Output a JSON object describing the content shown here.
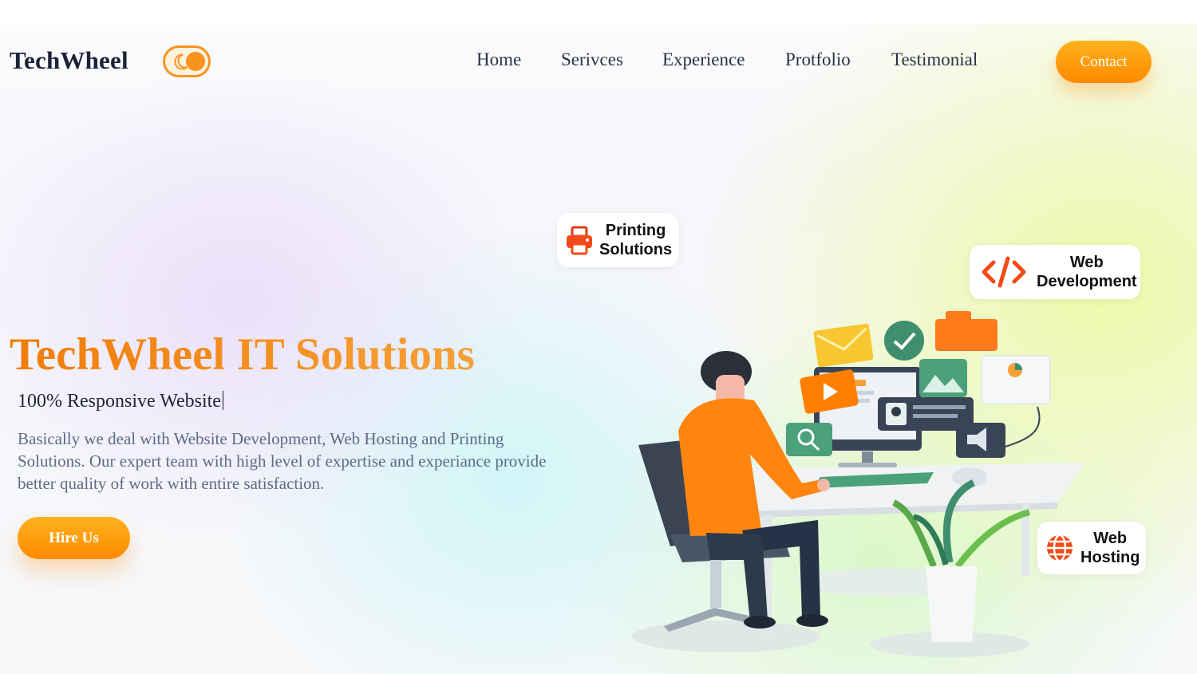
{
  "header": {
    "logo": "TechWheel",
    "nav": [
      {
        "label": "Home"
      },
      {
        "label": "Serivces"
      },
      {
        "label": "Experience"
      },
      {
        "label": "Protfolio"
      },
      {
        "label": "Testimonial"
      }
    ],
    "contact_label": "Contact"
  },
  "hero": {
    "title": "TechWheel IT Solutions",
    "subtitle": "100% Responsive Website",
    "description": "Basically we deal with Website Development, Web Hosting and Printing Solutions. Our expert team with high level of expertise and experiance provide better quality of work with entire satisfaction.",
    "cta_label": "Hire Us"
  },
  "services": {
    "printing": {
      "line1": "Printing",
      "line2": "Solutions",
      "icon": "printer-icon"
    },
    "web_dev": {
      "line1": "Web",
      "line2": "Development",
      "icon": "code-icon"
    },
    "web_hosting": {
      "line1": "Web",
      "line2": "Hosting",
      "icon": "globe-icon"
    }
  },
  "colors": {
    "accent": "#ff8a00",
    "accent_light": "#ffb21e",
    "logo_text": "#1c2238",
    "body_text": "#5d6b86"
  }
}
